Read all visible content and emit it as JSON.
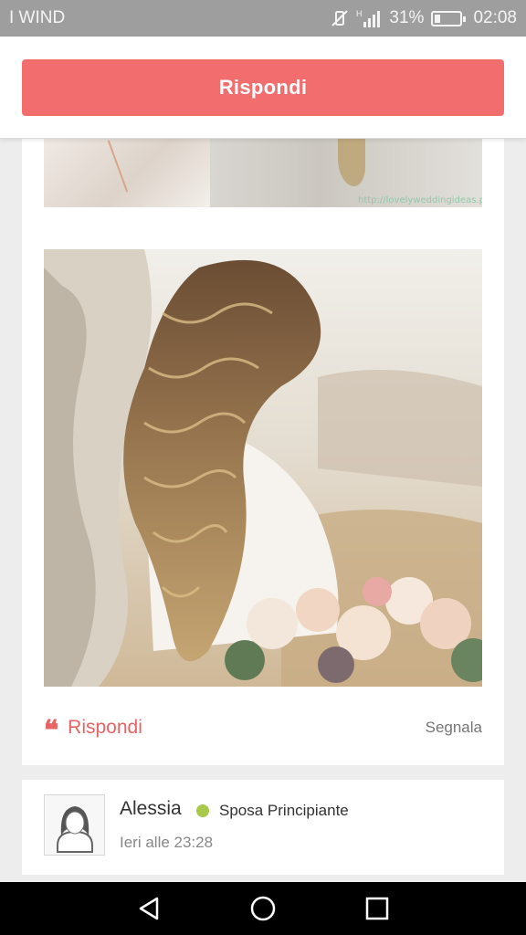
{
  "status_bar": {
    "carrier": "I WIND",
    "network_label": "H",
    "battery_percent": "31%",
    "battery_level": 0.31,
    "time": "02:08",
    "icons": [
      "vibrate-off-icon",
      "signal-icon",
      "battery-icon"
    ]
  },
  "top_bar": {
    "reply_label": "Rispondi",
    "accent_color": "#f26d6d"
  },
  "post": {
    "strip_watermark": "http://lovelyweddingideas.pl",
    "actions": {
      "reply_label": "Rispondi",
      "quote_icon": "❝",
      "report_label": "Segnala"
    }
  },
  "comment": {
    "author": "Alessia",
    "badge": "Sposa Principiante",
    "badge_color": "#a8c94a",
    "timestamp": "Ieri alle 23:28"
  },
  "nav_bar": {
    "icons": [
      "back-icon",
      "home-icon",
      "recents-icon"
    ]
  }
}
